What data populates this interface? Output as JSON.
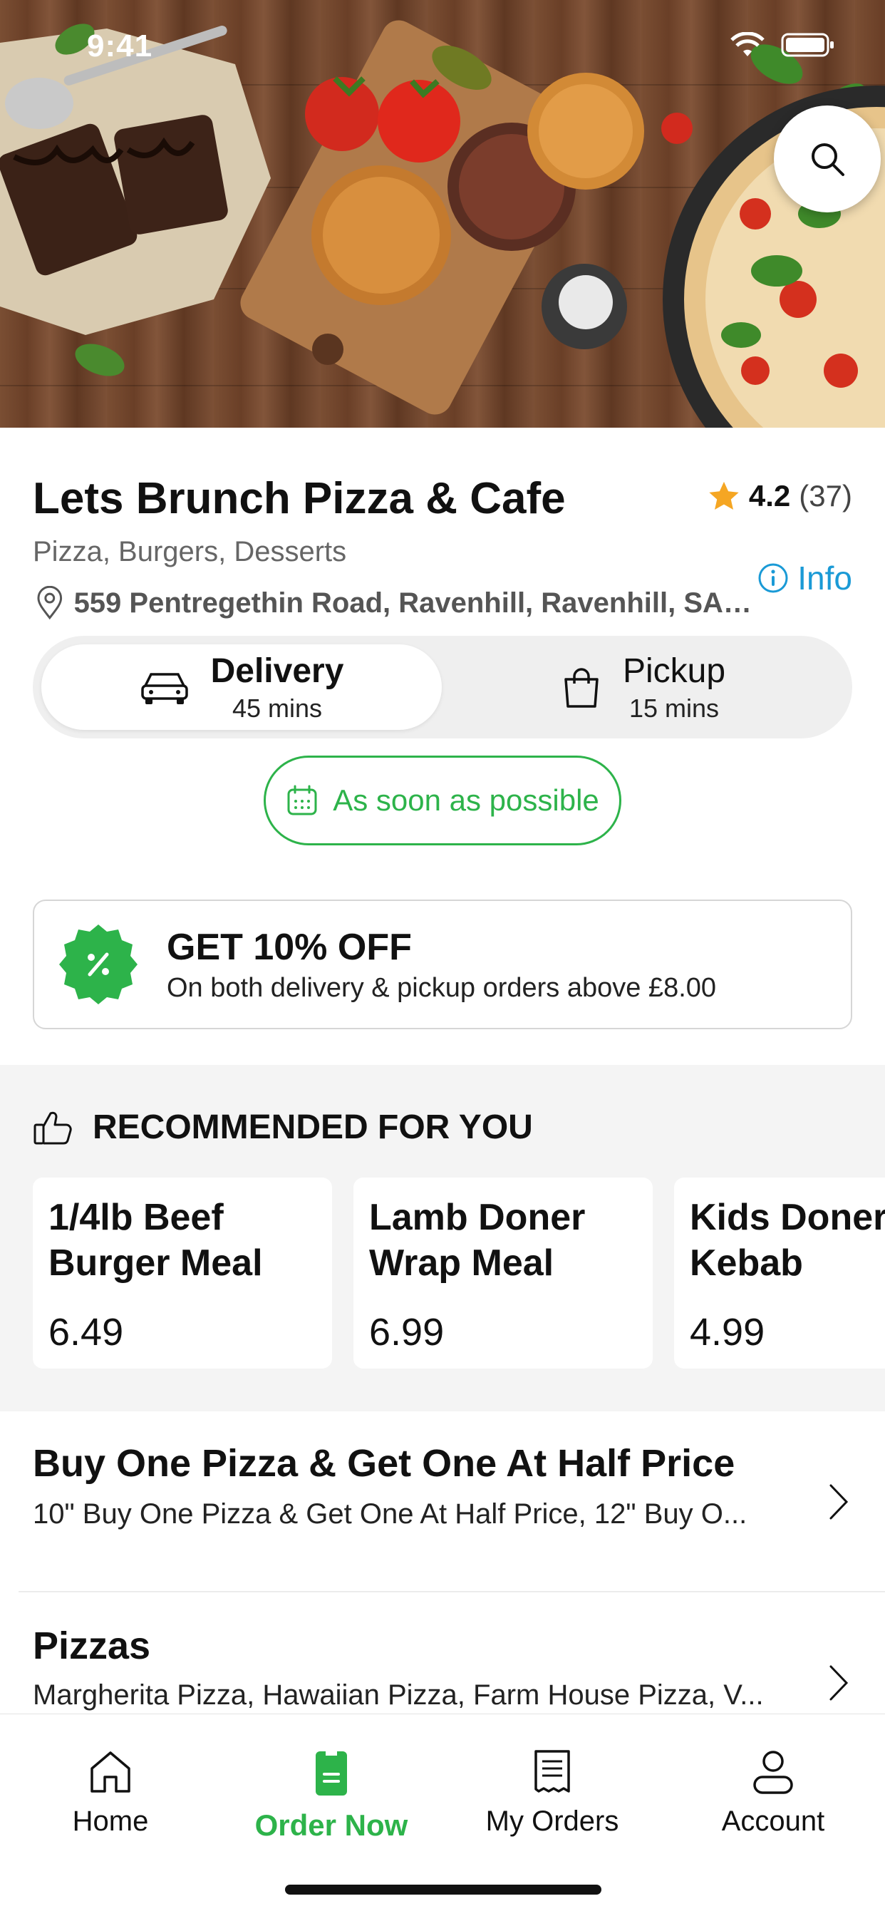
{
  "status_bar": {
    "time": "9:41"
  },
  "restaurant": {
    "name": "Lets Brunch Pizza & Cafe",
    "rating": "4.2",
    "rating_count": "(37)",
    "cuisines": "Pizza, Burgers, Desserts",
    "info_label": "Info",
    "address": "559 Pentregethin Road, Ravenhill, Ravenhill, SA5..."
  },
  "order_mode": {
    "delivery": {
      "label": "Delivery",
      "time": "45 mins",
      "selected": true
    },
    "pickup": {
      "label": "Pickup",
      "time": "15 mins",
      "selected": false
    },
    "schedule_label": "As soon as possible"
  },
  "offer": {
    "title": "GET 10% OFF",
    "description": "On both delivery & pickup orders above £8.00"
  },
  "recommended": {
    "heading": "RECOMMENDED FOR YOU",
    "items": [
      {
        "name": "1/4lb Beef Burger Meal",
        "price": "6.49"
      },
      {
        "name": "Lamb Doner Wrap Meal",
        "price": "6.99"
      },
      {
        "name": "Kids Doner Kebab",
        "price": "4.99"
      }
    ]
  },
  "categories": [
    {
      "name": "Buy One Pizza & Get One At Half Price",
      "description": "10\" Buy One Pizza & Get One At Half Price, 12\" Buy O..."
    },
    {
      "name": "Pizzas",
      "description": "Margherita Pizza, Hawaiian Pizza, Farm House Pizza, V..."
    }
  ],
  "tab_bar": {
    "tabs": [
      {
        "label": "Home",
        "icon": "home-icon"
      },
      {
        "label": "Order Now",
        "icon": "order-icon",
        "active": true
      },
      {
        "label": "My Orders",
        "icon": "receipt-icon"
      },
      {
        "label": "Account",
        "icon": "user-icon"
      }
    ]
  },
  "colors": {
    "accent": "#2db34a",
    "link": "#1a9ad6",
    "star": "#f5a623"
  }
}
